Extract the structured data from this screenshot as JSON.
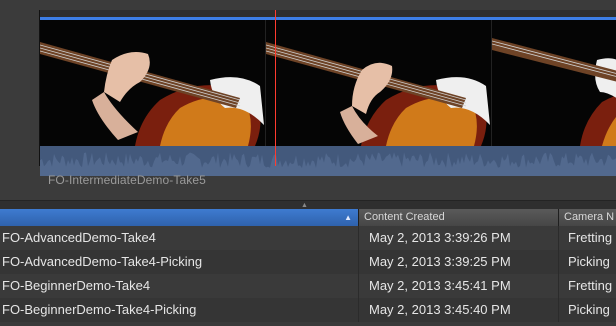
{
  "viewer": {
    "clip_name": "FO-IntermediateDemo-Take5",
    "icons": {
      "playhead": "playhead-marker",
      "splitter": "splitter-handle-icon"
    },
    "colors": {
      "accent_blue": "#3d7ee6",
      "playhead": "#ff3b30",
      "waveform": "#43597c"
    },
    "frames": [
      {
        "label": "thumbnail-1"
      },
      {
        "label": "thumbnail-2"
      },
      {
        "label": "thumbnail-3"
      }
    ]
  },
  "list": {
    "columns": [
      {
        "key": "name",
        "label": "",
        "sorted": true,
        "sort_icon": "sort-ascending-icon"
      },
      {
        "key": "created",
        "label": "Content Created"
      },
      {
        "key": "camera",
        "label": "Camera N"
      }
    ],
    "rows": [
      {
        "name": "FO-AdvancedDemo-Take4",
        "created": "May 2, 2013 3:39:26 PM",
        "camera": "Fretting"
      },
      {
        "name": "FO-AdvancedDemo-Take4-Picking",
        "created": "May 2, 2013 3:39:25 PM",
        "camera": "Picking"
      },
      {
        "name": "FO-BeginnerDemo-Take4",
        "created": "May 2, 2013 3:45:41 PM",
        "camera": "Fretting"
      },
      {
        "name": "FO-BeginnerDemo-Take4-Picking",
        "created": "May 2, 2013 3:45:40 PM",
        "camera": "Picking"
      }
    ]
  }
}
